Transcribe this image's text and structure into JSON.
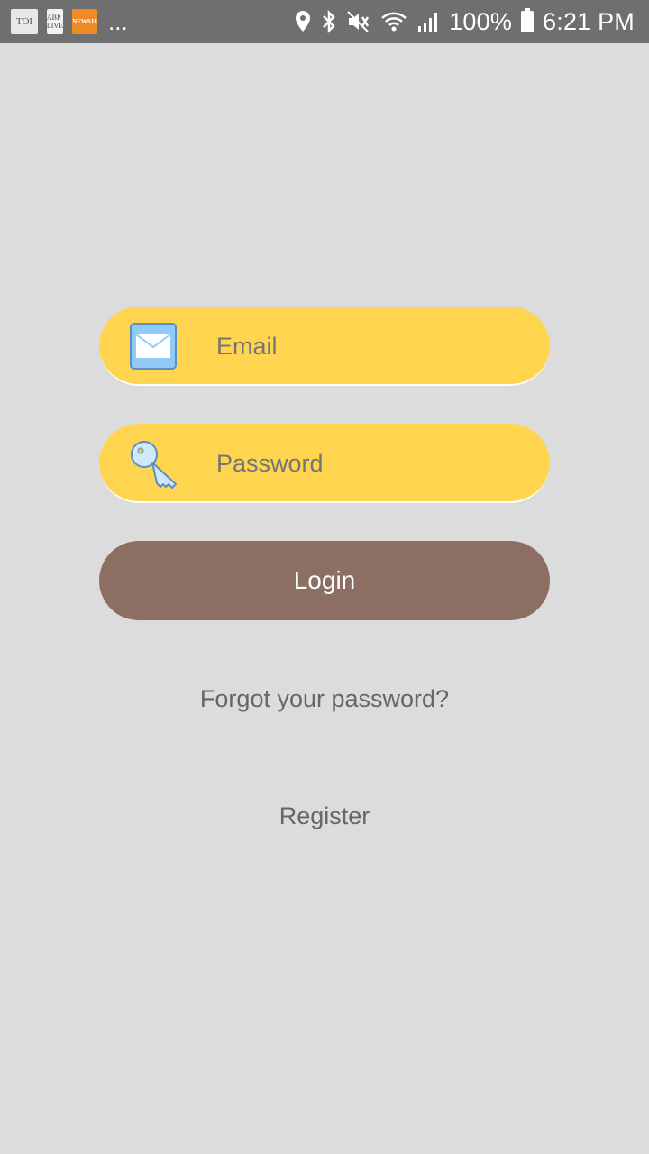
{
  "status_bar": {
    "notifications": [
      "TOI",
      "ABP LIVE",
      "NEWS18"
    ],
    "overflow": "...",
    "battery": "100%",
    "time": "6:21 PM",
    "icons": [
      "location-icon",
      "bluetooth-icon",
      "mute-icon",
      "wifi-icon",
      "signal-icon",
      "battery-icon"
    ]
  },
  "login_form": {
    "email": {
      "placeholder": "Email",
      "value": "",
      "icon": "envelope-icon"
    },
    "password": {
      "placeholder": "Password",
      "value": "",
      "icon": "key-icon"
    },
    "login_label": "Login",
    "forgot_label": "Forgot your password?",
    "register_label": "Register"
  },
  "colors": {
    "background": "#dcdcdc",
    "status_bar": "#6f6f6f",
    "field": "#ffd54f",
    "field_text": "#a8892a",
    "button": "#8d6e63",
    "link_text": "#666666"
  }
}
